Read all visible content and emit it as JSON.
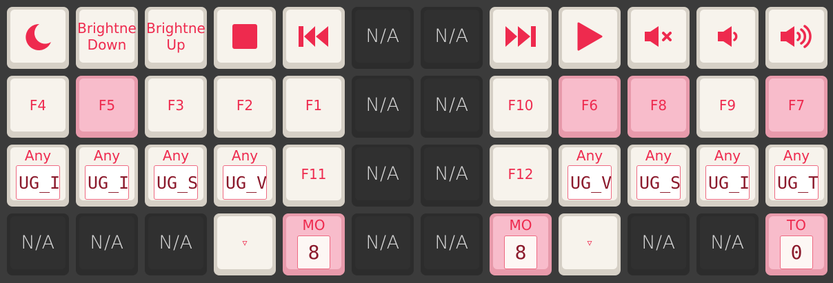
{
  "colors": {
    "accent": "#ee2a4e",
    "key_light": "#f7f3ec",
    "key_pink": "#f8bccb",
    "key_na": "#303030",
    "background": "#3b3b3b"
  },
  "rows": [
    [
      {
        "type": "icon",
        "style": "light",
        "icon": "moon-icon"
      },
      {
        "type": "text2",
        "style": "light",
        "line1": "Brightne",
        "line2": "Down"
      },
      {
        "type": "text2",
        "style": "light",
        "line1": "Brightne",
        "line2": "Up"
      },
      {
        "type": "icon",
        "style": "light",
        "icon": "stop-icon"
      },
      {
        "type": "icon",
        "style": "light",
        "icon": "previous-track-icon"
      },
      {
        "type": "na",
        "label": "N/A"
      },
      {
        "type": "na",
        "label": "N/A"
      },
      {
        "type": "icon",
        "style": "light",
        "icon": "next-track-icon"
      },
      {
        "type": "icon",
        "style": "light",
        "icon": "play-icon"
      },
      {
        "type": "icon",
        "style": "light",
        "icon": "volume-mute-icon"
      },
      {
        "type": "icon",
        "style": "light",
        "icon": "volume-down-icon"
      },
      {
        "type": "icon",
        "style": "light",
        "icon": "volume-up-icon"
      }
    ],
    [
      {
        "type": "fn",
        "style": "light",
        "label": "F4"
      },
      {
        "type": "fn",
        "style": "pink",
        "label": "F5"
      },
      {
        "type": "fn",
        "style": "light",
        "label": "F3"
      },
      {
        "type": "fn",
        "style": "light",
        "label": "F2"
      },
      {
        "type": "fn",
        "style": "light",
        "label": "F1"
      },
      {
        "type": "na",
        "label": "N/A"
      },
      {
        "type": "na",
        "label": "N/A"
      },
      {
        "type": "fn",
        "style": "light",
        "label": "F10"
      },
      {
        "type": "fn",
        "style": "pink",
        "label": "F6"
      },
      {
        "type": "fn",
        "style": "pink",
        "label": "F8"
      },
      {
        "type": "fn",
        "style": "light",
        "label": "F9"
      },
      {
        "type": "fn",
        "style": "pink",
        "label": "F7"
      }
    ],
    [
      {
        "type": "any",
        "style": "light",
        "label": "Any",
        "value": "UG_I"
      },
      {
        "type": "any",
        "style": "light",
        "label": "Any",
        "value": "UG_I"
      },
      {
        "type": "any",
        "style": "light",
        "label": "Any",
        "value": "UG_S"
      },
      {
        "type": "any",
        "style": "light",
        "label": "Any",
        "value": "UG_V"
      },
      {
        "type": "fn",
        "style": "light",
        "label": "F11"
      },
      {
        "type": "na",
        "label": "N/A"
      },
      {
        "type": "na",
        "label": "N/A"
      },
      {
        "type": "fn",
        "style": "light",
        "label": "F12"
      },
      {
        "type": "any",
        "style": "light",
        "label": "Any",
        "value": "UG_V"
      },
      {
        "type": "any",
        "style": "light",
        "label": "Any",
        "value": "UG_S"
      },
      {
        "type": "any",
        "style": "light",
        "label": "Any",
        "value": "UG_I"
      },
      {
        "type": "any",
        "style": "light",
        "label": "Any",
        "value": "UG_T"
      }
    ],
    [
      {
        "type": "na",
        "label": "N/A"
      },
      {
        "type": "na",
        "label": "N/A"
      },
      {
        "type": "na",
        "label": "N/A"
      },
      {
        "type": "trans",
        "style": "light",
        "symbol": "▿"
      },
      {
        "type": "layer",
        "style": "pink",
        "label": "MO",
        "value": "8"
      },
      {
        "type": "na",
        "label": "N/A"
      },
      {
        "type": "na",
        "label": "N/A"
      },
      {
        "type": "layer",
        "style": "pink",
        "label": "MO",
        "value": "8"
      },
      {
        "type": "trans",
        "style": "light",
        "symbol": "▿"
      },
      {
        "type": "na",
        "label": "N/A"
      },
      {
        "type": "na",
        "label": "N/A"
      },
      {
        "type": "layer",
        "style": "pink",
        "label": "TO",
        "value": "0"
      }
    ]
  ]
}
